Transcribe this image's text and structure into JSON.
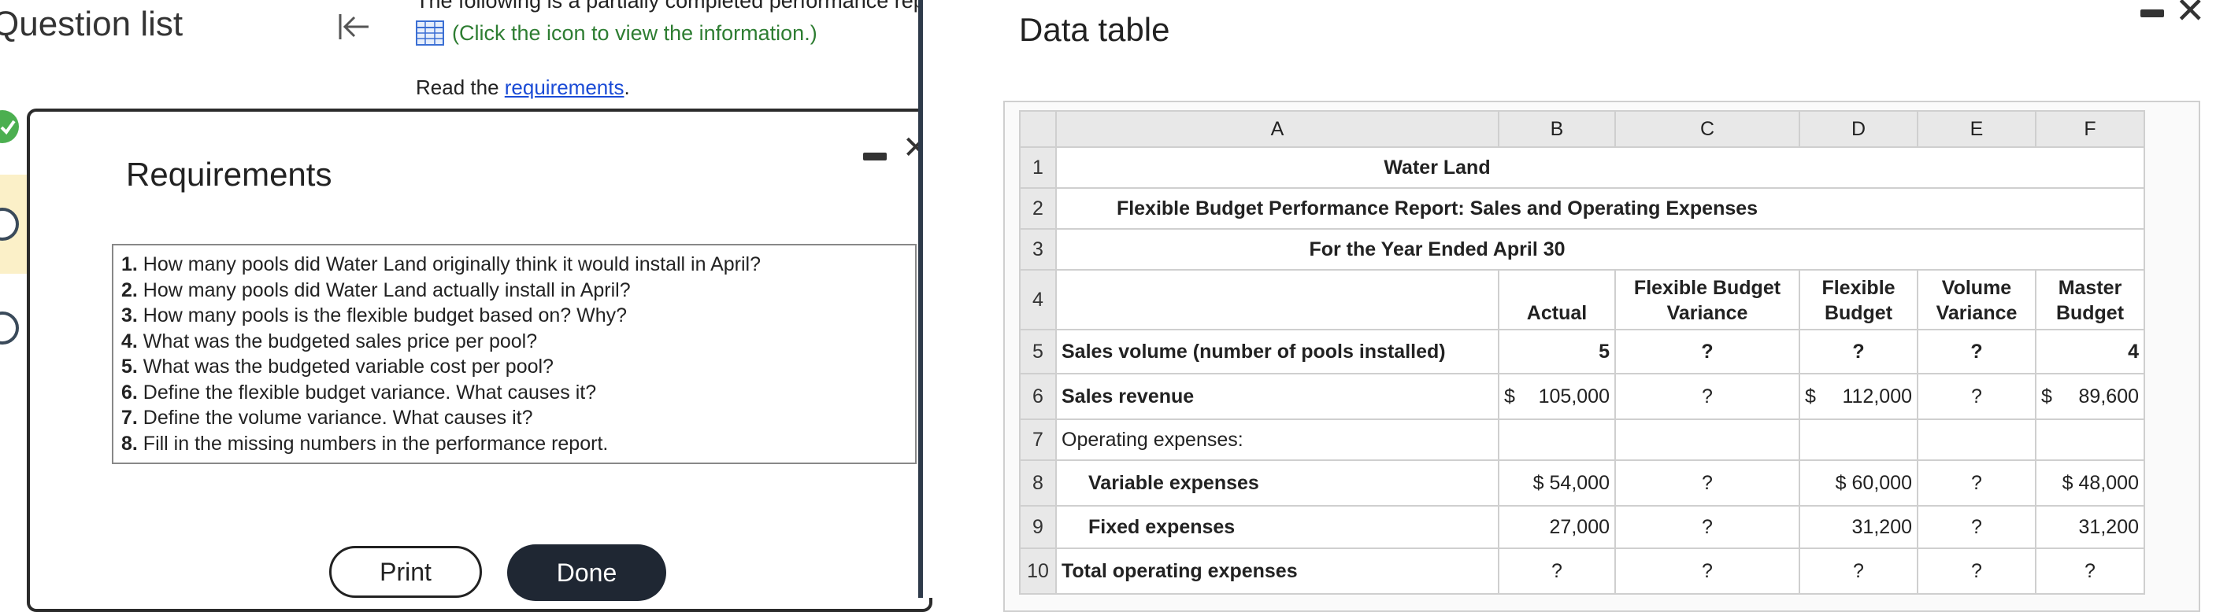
{
  "sidebar": {
    "title": "Question list",
    "collapse_icon": "collapse-left-icon"
  },
  "question": {
    "text_top": "The following is a partially completed performance repo",
    "info_link": "(Click the icon to view the information.)",
    "read_prefix": "Read the ",
    "read_link": "requirements",
    "read_suffix": "."
  },
  "requirements_modal": {
    "title": "Requirements",
    "items": [
      {
        "num": "1.",
        "text": " How many pools did Water Land originally think it would install in April?"
      },
      {
        "num": "2.",
        "text": " How many pools did Water Land actually install in April?"
      },
      {
        "num": "3.",
        "text": " How many pools is the flexible budget based on? Why?"
      },
      {
        "num": "4.",
        "text": " What was the budgeted sales price per pool?"
      },
      {
        "num": "5.",
        "text": " What was the budgeted variable cost per pool?"
      },
      {
        "num": "6.",
        "text": " Define the flexible budget variance. What causes it?"
      },
      {
        "num": "7.",
        "text": " Define the volume variance. What causes it?"
      },
      {
        "num": "8.",
        "text": " Fill in the missing numbers in the performance report."
      }
    ],
    "print_label": "Print",
    "done_label": "Done"
  },
  "data_table": {
    "title": "Data table",
    "columns": [
      "A",
      "B",
      "C",
      "D",
      "E",
      "F"
    ],
    "rows": {
      "r1": {
        "num": "1",
        "text": "Water Land"
      },
      "r2": {
        "num": "2",
        "text": "Flexible Budget Performance Report: Sales and Operating Expenses"
      },
      "r3": {
        "num": "3",
        "text": "For the Year Ended April 30"
      },
      "r4": {
        "num": "4",
        "actual": "Actual",
        "fbv_1": "Flexible Budget",
        "fbv_2": "Variance",
        "fb_1": "Flexible",
        "fb_2": "Budget",
        "vv_1": "Volume",
        "vv_2": "Variance",
        "mb_1": "Master",
        "mb_2": "Budget"
      },
      "r5": {
        "num": "5",
        "label": "Sales volume (number of pools installed)",
        "b": "5",
        "c": "?",
        "d": "?",
        "e": "?",
        "f": "4"
      },
      "r6": {
        "num": "6",
        "label": "Sales revenue",
        "b_sym": "$",
        "b": "105,000",
        "c": "?",
        "d_sym": "$",
        "d": "112,000",
        "e": "?",
        "f_sym": "$",
        "f": "89,600"
      },
      "r7": {
        "num": "7",
        "label": "Operating expenses:"
      },
      "r8": {
        "num": "8",
        "label": "Variable expenses",
        "b": "$ 54,000",
        "c": "?",
        "d": "$ 60,000",
        "e": "?",
        "f": "$ 48,000"
      },
      "r9": {
        "num": "9",
        "label": "Fixed expenses",
        "b": "27,000",
        "c": "?",
        "d": "31,200",
        "e": "?",
        "f": "31,200"
      },
      "r10": {
        "num": "10",
        "label": "Total operating expenses",
        "b": "?",
        "c": "?",
        "d": "?",
        "e": "?",
        "f": "?"
      }
    }
  },
  "colors": {
    "done_button": "#1f2733",
    "link_blue": "#1a4bd6",
    "info_green": "#2e7d32",
    "status_complete": "#4caf50",
    "status_current_bg": "#fbf0c8"
  }
}
